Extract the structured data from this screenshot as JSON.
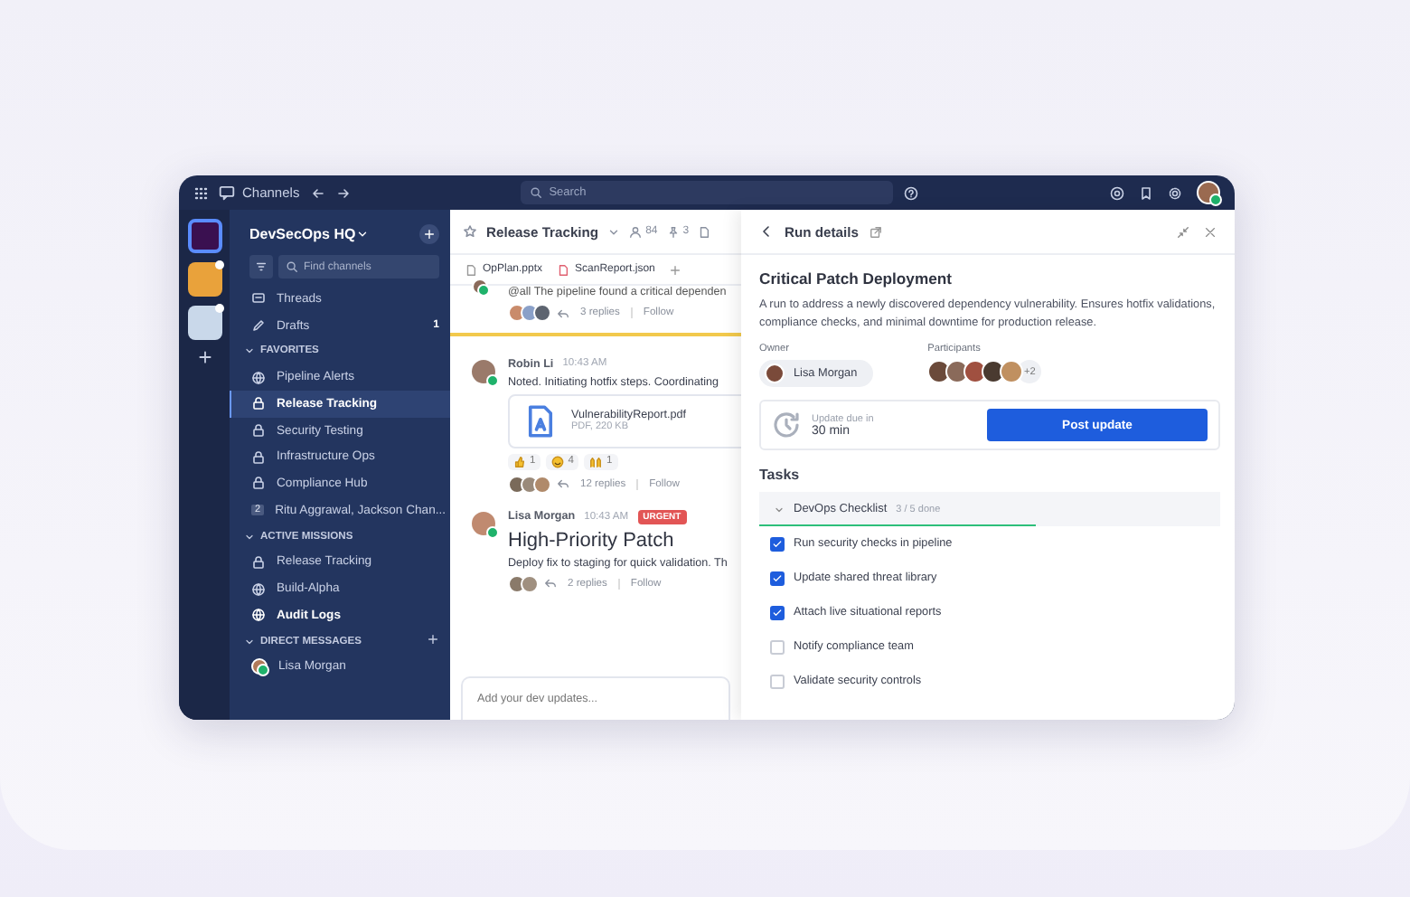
{
  "topbar": {
    "title": "Channels",
    "search_placeholder": "Search"
  },
  "workspaces": [
    {
      "selected": true,
      "unread": false,
      "color": "#3a1050"
    },
    {
      "selected": false,
      "unread": true,
      "color": "#e9a23b"
    },
    {
      "selected": false,
      "unread": true,
      "color": "#c9d8ea"
    }
  ],
  "sidebar": {
    "workspace": "DevSecOps HQ",
    "search_placeholder": "Find channels",
    "items": [
      {
        "kind": "threads",
        "label": "Threads"
      },
      {
        "kind": "drafts",
        "label": "Drafts",
        "count": "1"
      }
    ],
    "sections": [
      {
        "title": "FAVORITES",
        "expanded": true,
        "add": false,
        "items": [
          {
            "kind": "public",
            "label": "Pipeline Alerts",
            "selected": false,
            "unread": false
          },
          {
            "kind": "private",
            "label": "Release Tracking",
            "selected": true,
            "unread": true
          },
          {
            "kind": "private",
            "label": "Security Testing",
            "selected": false,
            "unread": false
          },
          {
            "kind": "private",
            "label": "Infrastructure Ops",
            "selected": false,
            "unread": false
          },
          {
            "kind": "private",
            "label": "Compliance Hub",
            "selected": false,
            "unread": false
          },
          {
            "kind": "group",
            "label": "Ritu Aggrawal, Jackson Chan...",
            "badge": "2",
            "selected": false,
            "unread": false
          }
        ]
      },
      {
        "title": "ACTIVE MISSIONS",
        "expanded": true,
        "add": false,
        "items": [
          {
            "kind": "private",
            "label": "Release Tracking",
            "selected": false,
            "unread": false
          },
          {
            "kind": "public",
            "label": "Build-Alpha",
            "selected": false,
            "unread": false
          },
          {
            "kind": "public",
            "label": "Audit Logs",
            "selected": false,
            "unread": true
          }
        ]
      },
      {
        "title": "DIRECT MESSAGES",
        "expanded": true,
        "add": true,
        "items": [
          {
            "kind": "person",
            "label": "Lisa Morgan",
            "selected": false,
            "unread": false
          }
        ]
      }
    ]
  },
  "chat": {
    "channel": "Release Tracking",
    "members": "84",
    "pins": "3",
    "files": [
      {
        "kind": "slides",
        "name": "OpPlan.pptx"
      },
      {
        "kind": "code",
        "name": "ScanReport.json"
      }
    ],
    "messages": [
      {
        "kind": "tail",
        "text": "@all The pipeline found a critical dependen",
        "replies": "3 replies",
        "follow": "Follow",
        "repliers": [
          {
            "color": "#c98b6b"
          },
          {
            "color": "#8aa0c8"
          },
          {
            "color": "#5d6470"
          }
        ]
      },
      {
        "kind": "new-divider"
      },
      {
        "kind": "message",
        "author": "Robin Li",
        "time": "10:43 AM",
        "text": "Noted. Initiating hotfix steps. Coordinating",
        "attachment": {
          "name": "VulnerabilityReport.pdf",
          "meta": "PDF, 220 KB"
        },
        "reactions": [
          {
            "kind": "thumbs",
            "count": "1"
          },
          {
            "kind": "smile",
            "count": "4"
          },
          {
            "kind": "hands",
            "count": "1"
          }
        ],
        "replies": "12 replies",
        "follow": "Follow",
        "repliers": [
          {
            "color": "#7a6a5a"
          },
          {
            "color": "#9a8a7a"
          },
          {
            "color": "#b08a6a"
          }
        ]
      },
      {
        "kind": "message",
        "author": "Lisa Morgan",
        "time": "10:43 AM",
        "badge": "URGENT",
        "title": "High-Priority Patch",
        "text": "Deploy fix to staging for quick validation. Th",
        "replies": "2 replies",
        "follow": "Follow",
        "repliers": [
          {
            "color": "#8a7a6a"
          },
          {
            "color": "#a09080"
          }
        ]
      }
    ],
    "composer_placeholder": "Add your dev updates..."
  },
  "panel": {
    "title": "Run details",
    "heading": "Critical Patch Deployment",
    "description": "A run to address a newly discovered dependency vulnerability. Ensures hotfix validations, compliance checks, and minimal downtime for production release.",
    "owner_label": "Owner",
    "owner": "Lisa Morgan",
    "participants_label": "Participants",
    "participants": [
      {
        "color": "#6b4a3a"
      },
      {
        "color": "#8a6a5a"
      },
      {
        "color": "#a05040"
      },
      {
        "color": "#4a3a30"
      },
      {
        "color": "#c09060"
      }
    ],
    "participants_more": "+2",
    "due_label": "Update due in",
    "due": "30 min",
    "button": "Post update",
    "tasks_title": "Tasks",
    "checklist": {
      "title": "DevOps Checklist",
      "progress": "3 / 5 done",
      "level": 0.6,
      "expanded": true
    },
    "tasks": [
      {
        "label": "Run security checks in pipeline",
        "checked": true
      },
      {
        "label": "Update shared threat library",
        "checked": true
      },
      {
        "label": "Attach live situational reports",
        "checked": true
      },
      {
        "label": "Notify compliance team",
        "checked": false
      },
      {
        "label": "Validate security controls",
        "checked": false
      }
    ]
  }
}
